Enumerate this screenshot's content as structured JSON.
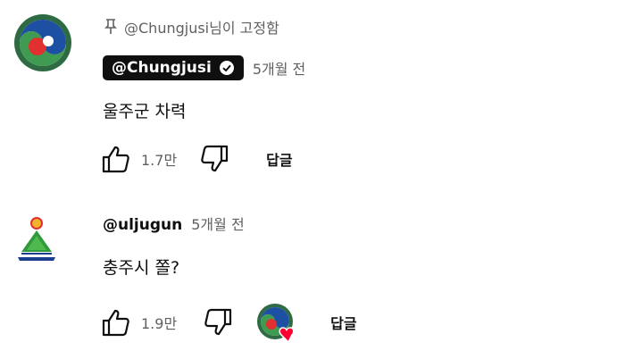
{
  "comments": [
    {
      "pinned_text": "@Chungjusi님이 고정함",
      "author": "@Chungjusi",
      "verified": true,
      "time": "5개월 전",
      "text": "울주군 차력",
      "likes": "1.7만",
      "reply_label": "답글",
      "avatar_icon": "chungju-logo-icon"
    },
    {
      "author": "@uljugun",
      "time": "5개월 전",
      "text": "충주시 쫄?",
      "likes": "1.9만",
      "reply_label": "답글",
      "avatar_icon": "ulju-logo-icon",
      "hearted_by_creator": true
    }
  ],
  "colors": {
    "chip_bg": "#0f0f0f",
    "meta_text": "#606060",
    "heart": "#ff0033"
  }
}
